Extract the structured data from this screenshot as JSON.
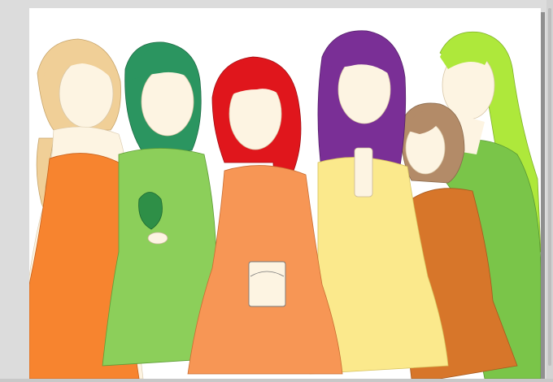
{
  "app": {
    "workspace_color": "#dcdcdc",
    "canvas_color": "#ffffff"
  },
  "artwork": {
    "subject": "six-girls-in-dresses-illustration",
    "figures": [
      {
        "name": "girl-1",
        "hair": "#f0cf97",
        "dress": "#f7842f"
      },
      {
        "name": "girl-2",
        "hair": "#2b9560",
        "dress": "#8ccf5a"
      },
      {
        "name": "girl-3",
        "hair": "#e0161c",
        "dress": "#f79655"
      },
      {
        "name": "girl-4",
        "hair": "#7a2f96",
        "dress": "#fbe98c"
      },
      {
        "name": "girl-5",
        "hair": "#b38b68",
        "dress": "#d7762a"
      },
      {
        "name": "girl-6",
        "hair": "#aee83b",
        "dress": "#7ac549"
      }
    ],
    "skin": "#fdf4e2",
    "props": [
      "green-pouch-icon",
      "treasure-box-icon",
      "bottle-icon"
    ]
  }
}
